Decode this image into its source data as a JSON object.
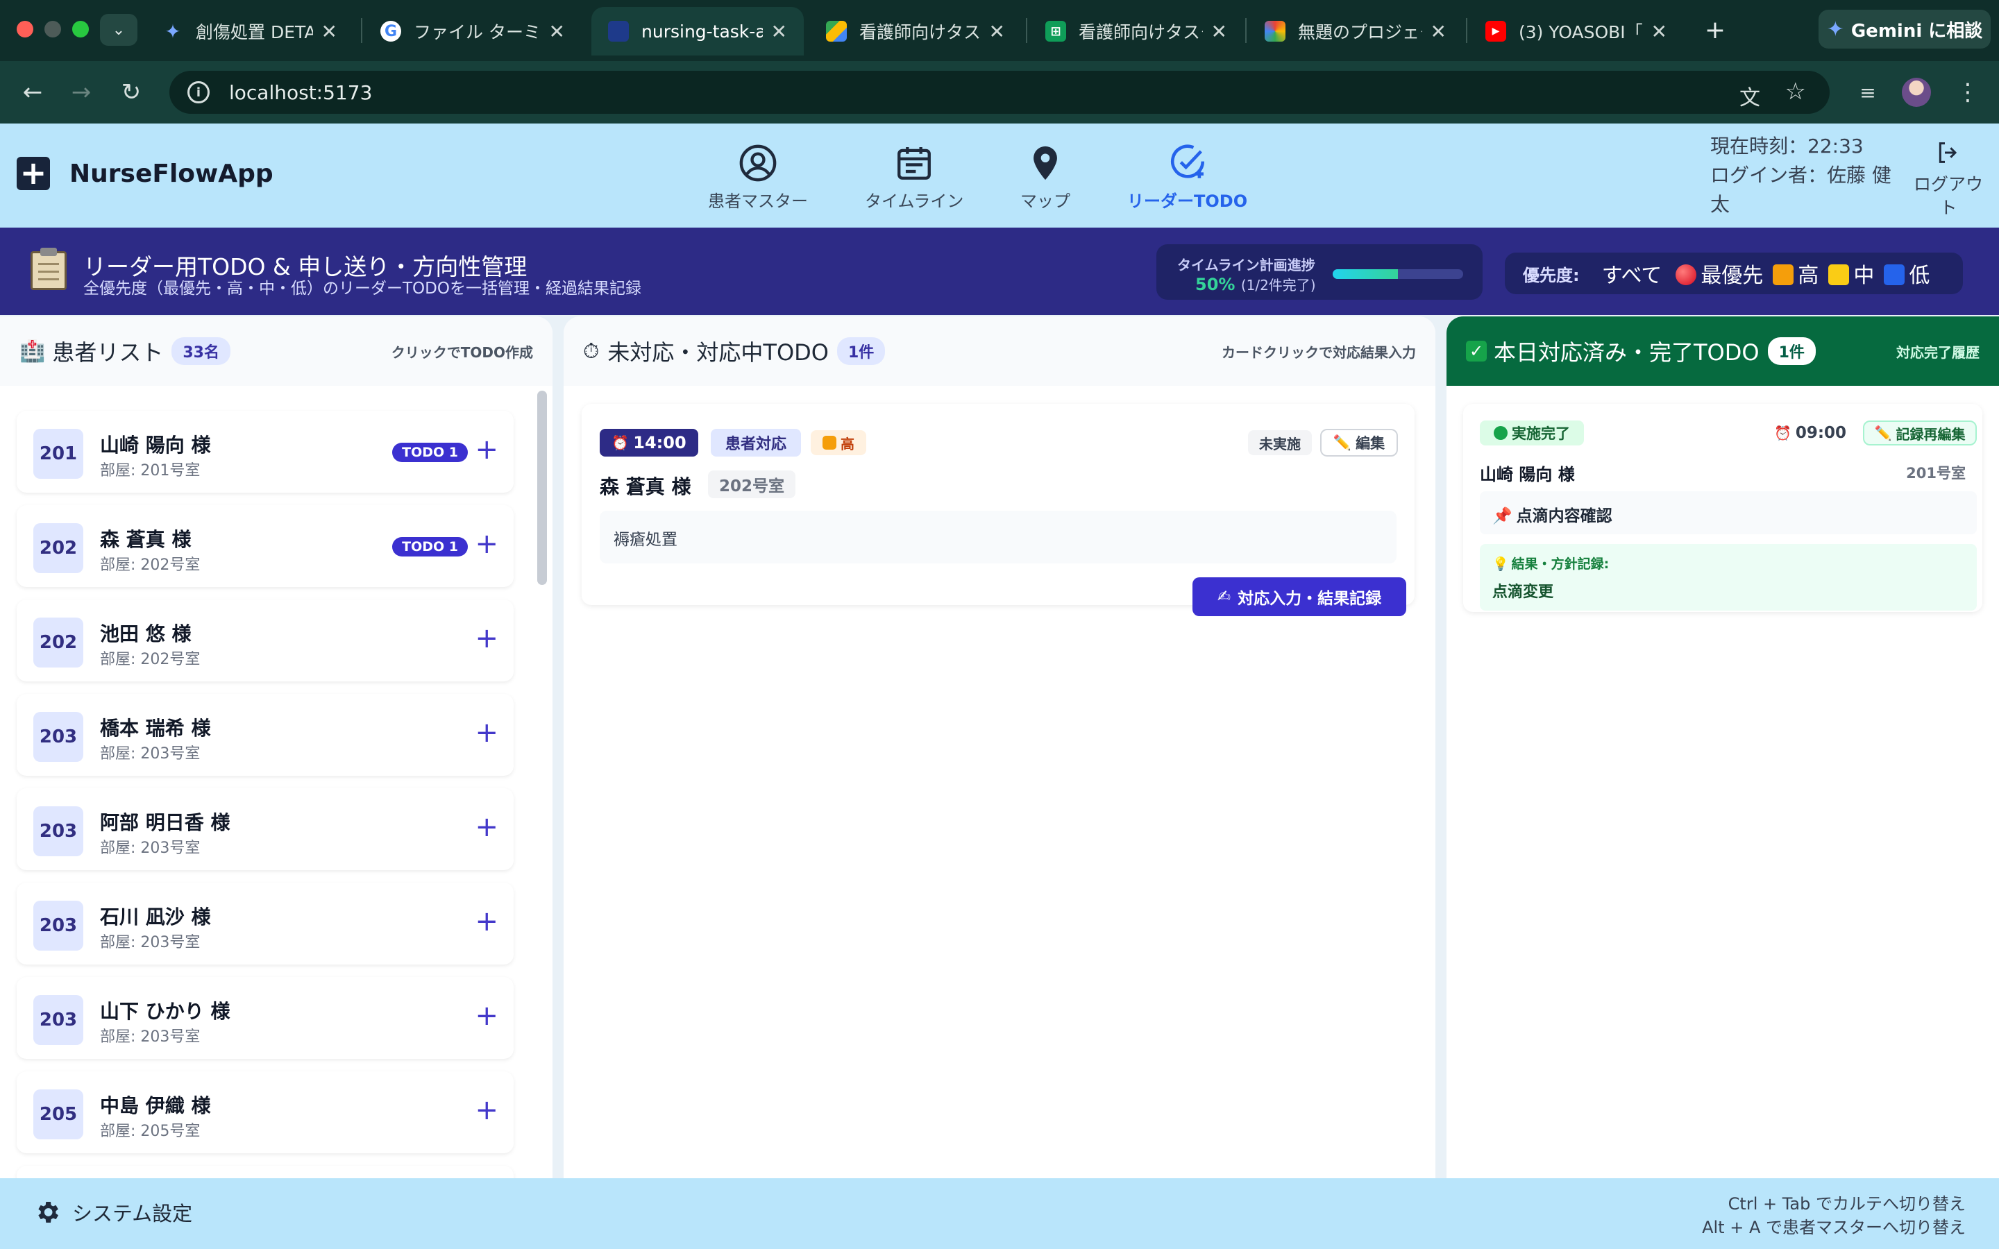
{
  "browser": {
    "tabs": [
      {
        "title": "創傷処置 DETAIL",
        "icon": "gemini-icon"
      },
      {
        "title": "ファイル ターミナ",
        "icon": "google-icon"
      },
      {
        "title": "nursing-task-ap",
        "icon": "app-icon"
      },
      {
        "title": "看護師向けタスク",
        "icon": "drive-icon"
      },
      {
        "title": "看護師向けタスク",
        "icon": "sheets-icon"
      },
      {
        "title": "無題のプロジェク",
        "icon": "colab-icon"
      },
      {
        "title": "(3) YOASOBI「",
        "icon": "youtube-icon"
      }
    ],
    "gemini_button": "Gemini に相談",
    "url": "localhost:5173"
  },
  "app": {
    "name": "NurseFlowApp",
    "nav": [
      {
        "label": "患者マスター",
        "icon": "user-circle-icon"
      },
      {
        "label": "タイムライン",
        "icon": "calendar-icon"
      },
      {
        "label": "マップ",
        "icon": "map-pin-icon"
      },
      {
        "label": "リーダーTODO",
        "icon": "check-circle-icon"
      }
    ],
    "active_nav": "リーダーTODO",
    "clock": "現在時刻：22:33",
    "login_user": "ログイン者：佐藤 健太",
    "logout": "ログアウト"
  },
  "banner": {
    "title": "リーダー用TODO & 申し送り・方向性管理",
    "subtitle": "全優先度（最優先・高・中・低）のリーダーTODOを一括管理・経過結果記録",
    "progress_label": "タイムライン計画進捗",
    "progress_pct": "50%",
    "progress_detail": "(1/2件完了)",
    "progress_value": 0.5,
    "priority_label": "優先度:",
    "priority_filters": [
      "すべて",
      "最優先",
      "高",
      "中",
      "低"
    ],
    "priority_colors": {
      "最優先": "#e11d2e",
      "高": "#f59e0b",
      "中": "#facc15",
      "低": "#2563eb"
    }
  },
  "patients_panel": {
    "title": "患者リスト",
    "count": "33名",
    "hint": "クリックでTODO作成",
    "patients": [
      {
        "room": "201",
        "name": "山崎 陽向 様",
        "sub": "部屋: 201号室",
        "badge": "TODO 1"
      },
      {
        "room": "202",
        "name": "森 蒼真 様",
        "sub": "部屋: 202号室",
        "badge": "TODO 1"
      },
      {
        "room": "202",
        "name": "池田 悠 様",
        "sub": "部屋: 202号室",
        "badge": ""
      },
      {
        "room": "203",
        "name": "橋本 瑞希 様",
        "sub": "部屋: 203号室",
        "badge": ""
      },
      {
        "room": "203",
        "name": "阿部 明日香 様",
        "sub": "部屋: 203号室",
        "badge": ""
      },
      {
        "room": "203",
        "name": "石川 凪沙 様",
        "sub": "部屋: 203号室",
        "badge": ""
      },
      {
        "room": "203",
        "name": "山下 ひかり 様",
        "sub": "部屋: 203号室",
        "badge": ""
      },
      {
        "room": "205",
        "name": "中島 伊織 様",
        "sub": "部屋: 205号室",
        "badge": ""
      }
    ]
  },
  "pending_panel": {
    "title": "未対応・対応中TODO",
    "count": "1件",
    "hint": "カードクリックで対応結果入力",
    "todo": {
      "time": "14:00",
      "category": "患者対応",
      "priority": "高",
      "status": "未実施",
      "edit": "編集",
      "patient": "森 蒼真 様",
      "room": "202号室",
      "content": "褥瘡処置",
      "action": "対応入力・結果記録"
    }
  },
  "done_panel": {
    "title": "本日対応済み・完了TODO",
    "count": "1件",
    "hint": "対応完了履歴",
    "todo": {
      "status": "実施完了",
      "time": "09:00",
      "edit": "記録再編集",
      "patient": "山崎 陽向 様",
      "room": "201号室",
      "content": "点滴内容確認",
      "result_label": "結果・方針記録:",
      "result": "点滴変更"
    }
  },
  "footer": {
    "settings": "システム設定",
    "hint_line1": "Ctrl + Tab でカルテへ切り替え",
    "hint_line2": "Alt + A で患者マスターへ切り替え"
  }
}
